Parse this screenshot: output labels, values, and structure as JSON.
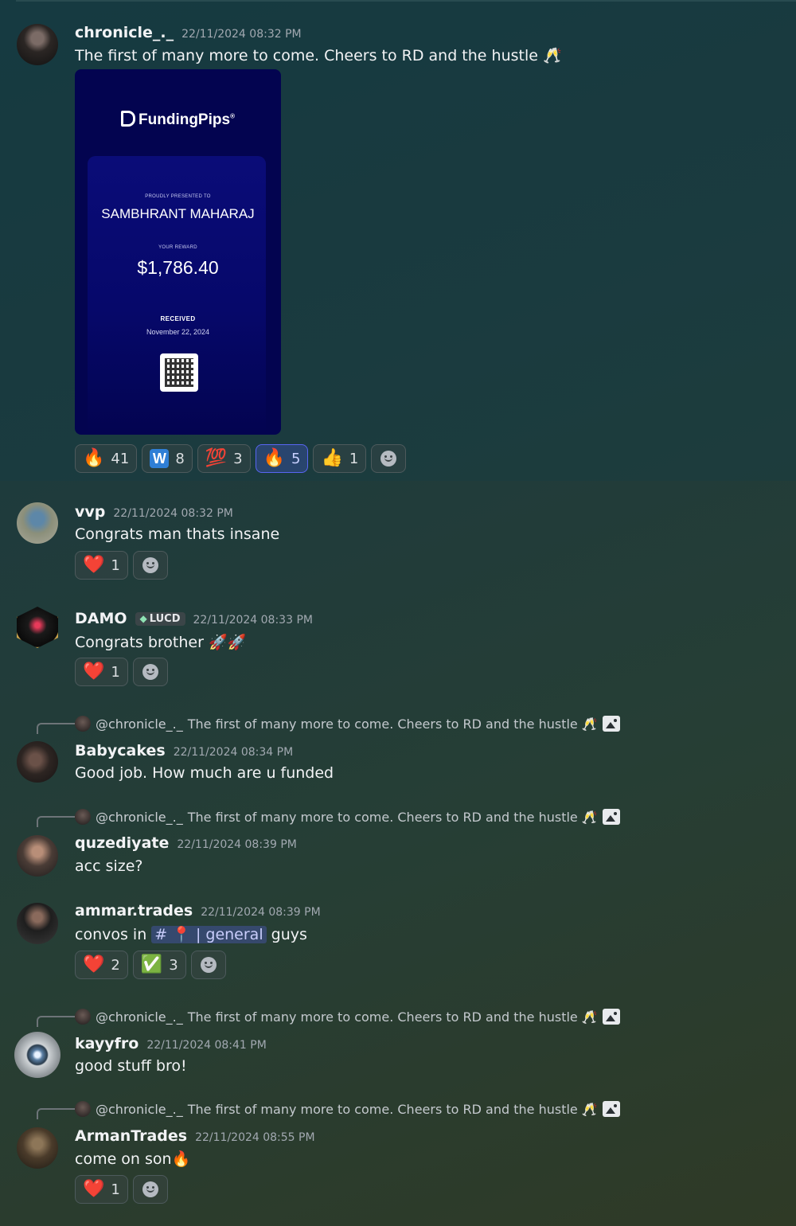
{
  "messages": [
    {
      "user": "chronicle_._",
      "timestamp": "22/11/2024 08:32 PM",
      "text": "The first of many more to come. Cheers to RD and the hustle 🥂",
      "attachment": {
        "brand": "FundingPips",
        "brand_mark": "®",
        "presented_label": "PROUDLY PRESENTED TO",
        "recipient": "SAMBHRANT MAHARAJ",
        "reward_label": "YOUR REWARD",
        "reward": "$1,786.40",
        "received_label": "RECEIVED",
        "received_date": "November 22, 2024",
        "bg_color": "#030450"
      },
      "reactions": [
        {
          "emoji": "🔥",
          "count": "41"
        },
        {
          "emoji": "🇼",
          "count": "8"
        },
        {
          "emoji": "💯",
          "count": "3"
        },
        {
          "emoji": "🔥",
          "count": "5",
          "selected": true
        },
        {
          "emoji": "👍",
          "count": "1"
        }
      ]
    },
    {
      "user": "vvp",
      "timestamp": "22/11/2024 08:32 PM",
      "text": "Congrats man thats insane",
      "reactions": [
        {
          "emoji": "❤️",
          "count": "1"
        }
      ]
    },
    {
      "user": "DAMO",
      "badge": "LUCD",
      "timestamp": "22/11/2024 08:33 PM",
      "text": "Congrats brother 🚀🚀",
      "reactions": [
        {
          "emoji": "❤️",
          "count": "1"
        }
      ]
    },
    {
      "reply_to": "@chronicle_._",
      "reply_text": "The first of many more to come. Cheers to RD and the hustle 🥂",
      "user": "Babycakes",
      "timestamp": "22/11/2024 08:34 PM",
      "text": "Good job. How much are u funded"
    },
    {
      "reply_to": "@chronicle_._",
      "reply_text": "The first of many more to come. Cheers to RD and the hustle 🥂",
      "user": "quzediyate",
      "timestamp": "22/11/2024 08:39 PM",
      "text": "acc size?"
    },
    {
      "user": "ammar.trades",
      "timestamp": "22/11/2024 08:39 PM",
      "text_before": "convos in",
      "channel": "# 📍 | general",
      "text_after": "guys",
      "reactions": [
        {
          "emoji": "❤️",
          "count": "2"
        },
        {
          "emoji": "✅",
          "count": "3"
        }
      ]
    },
    {
      "reply_to": "@chronicle_._",
      "reply_text": "The first of many more to come. Cheers to RD and the hustle 🥂",
      "user": "kayyfro",
      "timestamp": "22/11/2024 08:41 PM",
      "text": "good stuff bro!"
    },
    {
      "reply_to": "@chronicle_._",
      "reply_text": "The first of many more to come. Cheers to RD and the hustle 🥂",
      "user": "ArmanTrades",
      "timestamp": "22/11/2024 08:55 PM",
      "text": "come on son🔥",
      "reactions": [
        {
          "emoji": "❤️",
          "count": "1"
        }
      ]
    }
  ],
  "icons": {
    "add_reaction": "smiley-icon",
    "image_attachment": "image-icon",
    "badge_icon": "gem-icon"
  },
  "colors": {
    "channel_mention": "#5865f2",
    "selected_reaction": "#5865f2"
  }
}
